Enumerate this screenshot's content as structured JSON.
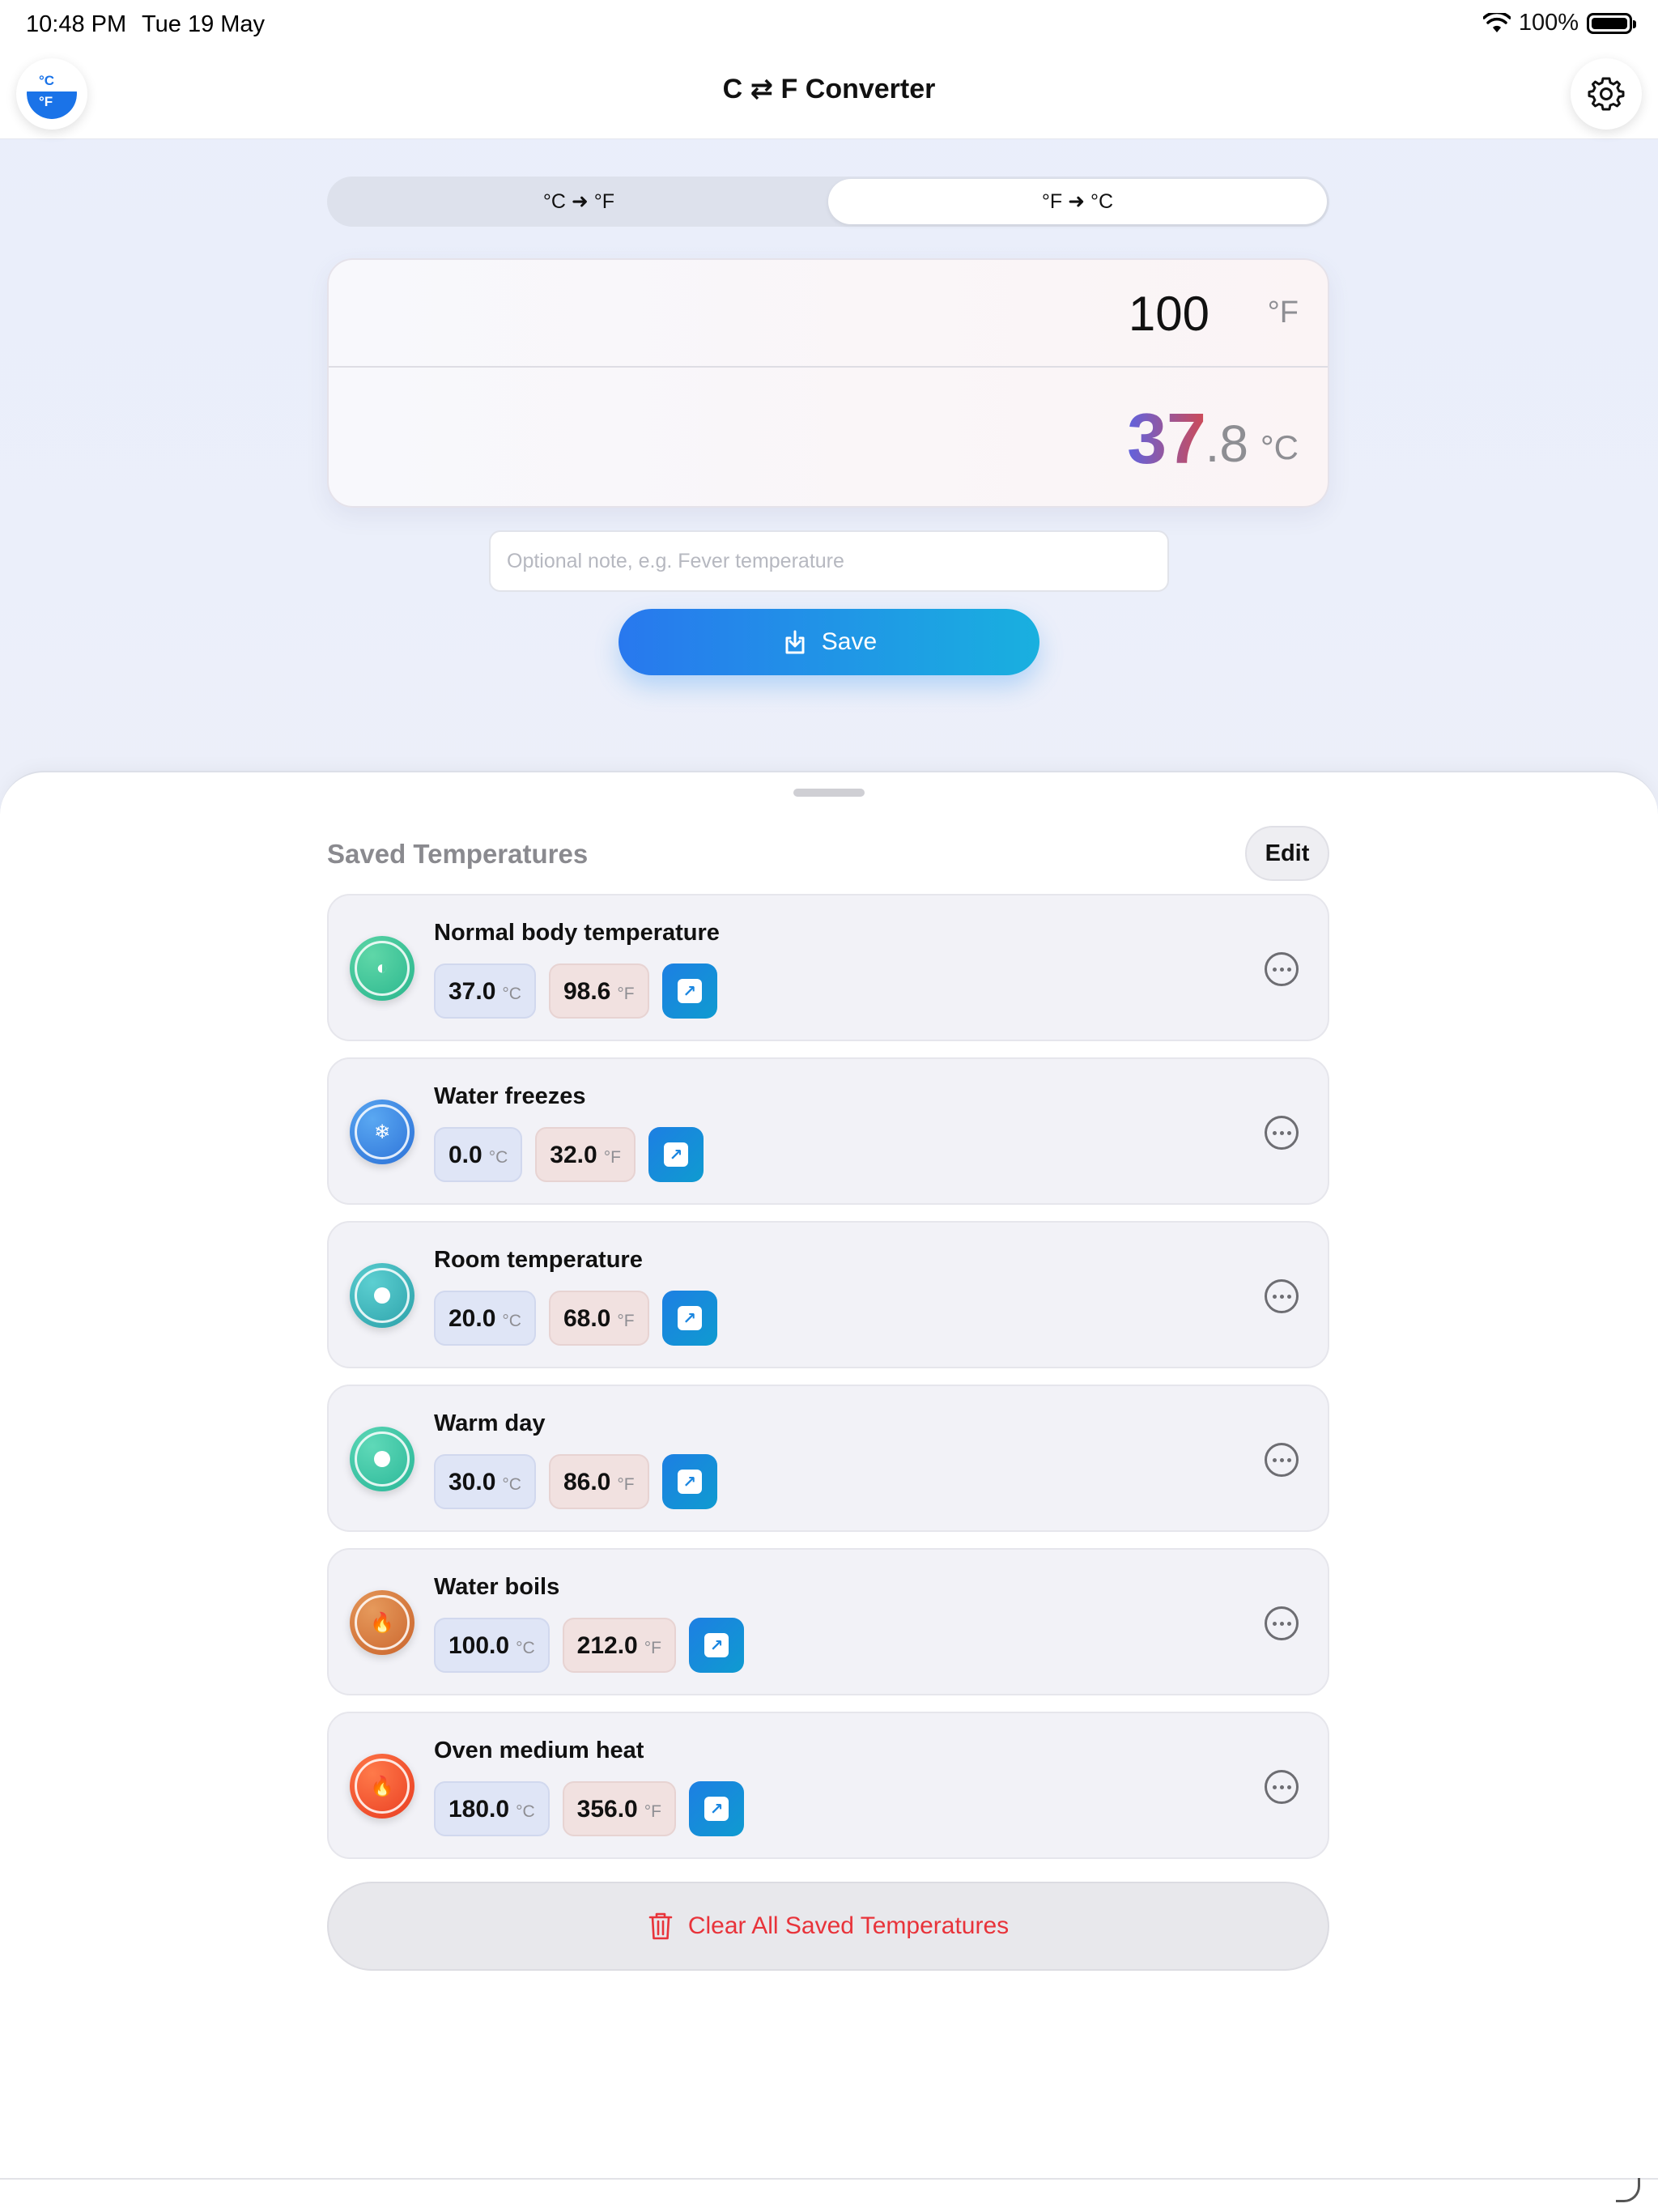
{
  "status_bar": {
    "time": "10:48 PM",
    "date": "Tue 19 May",
    "battery": "100%"
  },
  "nav": {
    "title": "C ⇄ F Converter",
    "logo_c": "°C",
    "logo_f": "°F"
  },
  "segments": {
    "c_to_f": "°C ➜ °F",
    "f_to_c": "°F ➜ °C",
    "active": "f_to_c"
  },
  "converter": {
    "input_value": "100",
    "input_unit": "°F",
    "result_int": "37",
    "result_dec": ".8",
    "result_unit": "°C"
  },
  "note": {
    "placeholder": "Optional note, e.g. Fever temperature",
    "value": ""
  },
  "save_label": "Save",
  "saved": {
    "title": "Saved Temperatures",
    "edit_label": "Edit",
    "items": [
      {
        "name": "Normal body temperature",
        "c": "37.0",
        "c_unit": "°C",
        "f": "98.6",
        "f_unit": "°F",
        "icon": "half-circle-icon",
        "glyph": "◐",
        "color_a": "#5fd7a8",
        "color_b": "#27b48c"
      },
      {
        "name": "Water freezes",
        "c": "0.0",
        "c_unit": "°C",
        "f": "32.0",
        "f_unit": "°F",
        "icon": "snowflake-icon",
        "glyph": "❄",
        "color_a": "#5aa8f2",
        "color_b": "#2a6fd6"
      },
      {
        "name": "Room temperature",
        "c": "20.0",
        "c_unit": "°C",
        "f": "68.0",
        "f_unit": "°F",
        "icon": "dot-icon",
        "glyph": "",
        "color_a": "#5ccfd1",
        "color_b": "#2a9fa8"
      },
      {
        "name": "Warm day",
        "c": "30.0",
        "c_unit": "°C",
        "f": "86.0",
        "f_unit": "°F",
        "icon": "dot-icon",
        "glyph": "",
        "color_a": "#5fd9b8",
        "color_b": "#27b596"
      },
      {
        "name": "Water boils",
        "c": "100.0",
        "c_unit": "°C",
        "f": "212.0",
        "f_unit": "°F",
        "icon": "flame-icon",
        "glyph": "🔥",
        "color_a": "#e69a5c",
        "color_b": "#c9622a"
      },
      {
        "name": "Oven medium heat",
        "c": "180.0",
        "c_unit": "°C",
        "f": "356.0",
        "f_unit": "°F",
        "icon": "flame-icon",
        "glyph": "🔥",
        "color_a": "#ff7a4a",
        "color_b": "#e83a1f"
      }
    ],
    "clear_label": "Clear All Saved Temperatures"
  }
}
